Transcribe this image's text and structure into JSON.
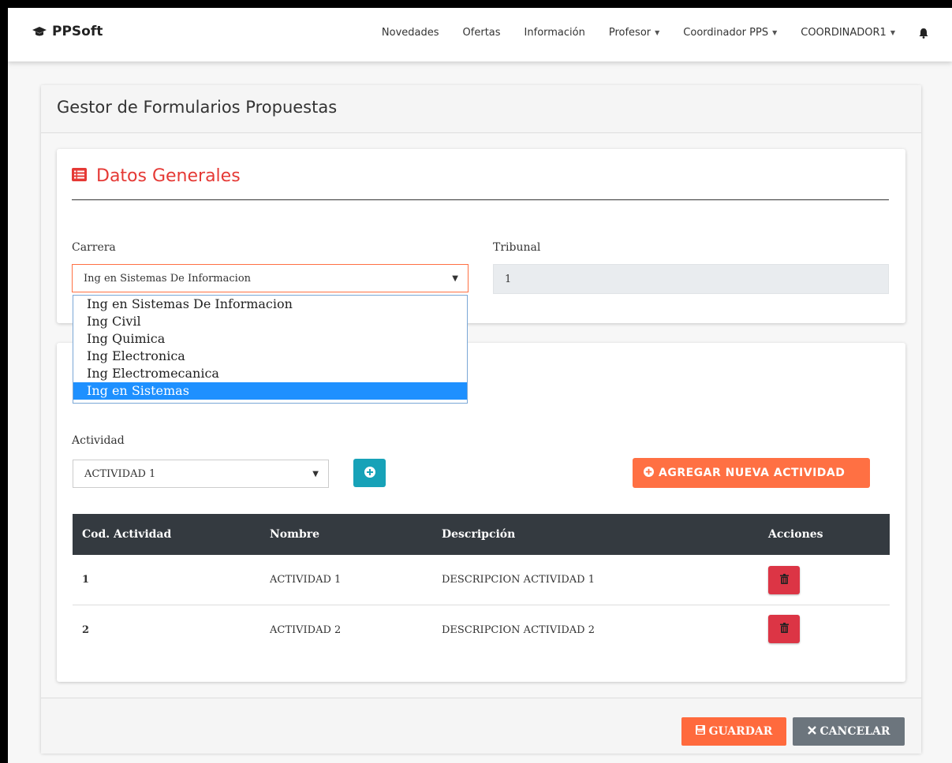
{
  "navbar": {
    "brand": "PPSoft",
    "items": [
      {
        "label": "Novedades",
        "dropdown": false
      },
      {
        "label": "Ofertas",
        "dropdown": false
      },
      {
        "label": "Información",
        "dropdown": false
      },
      {
        "label": "Profesor",
        "dropdown": true
      },
      {
        "label": "Coordinador PPS",
        "dropdown": true
      },
      {
        "label": "COORDINADOR1",
        "dropdown": true
      }
    ],
    "notification_icon": "bell-icon"
  },
  "page": {
    "title": "Gestor de Formularios Propuestas"
  },
  "datos_generales": {
    "title": "Datos Generales",
    "icon": "list-alt-icon",
    "carrera_label": "Carrera",
    "carrera_value": "Ing en Sistemas De Informacion",
    "carrera_options": [
      "Ing en Sistemas De Informacion",
      "Ing Civil",
      "Ing Quimica",
      "Ing Electronica",
      "Ing Electromecanica",
      "Ing en Sistemas"
    ],
    "carrera_highlighted": "Ing en Sistemas",
    "tribunal_label": "Tribunal",
    "tribunal_value": "1"
  },
  "actividades": {
    "label": "Actividad",
    "selected": "ACTIVIDAD 1",
    "add_button": "AGREGAR NUEVA ACTIVIDAD",
    "columns": [
      "Cod. Actividad",
      "Nombre",
      "Descripción",
      "Acciones"
    ],
    "rows": [
      {
        "cod": "1",
        "nombre": "ACTIVIDAD 1",
        "descripcion": "DESCRIPCION ACTIVIDAD 1"
      },
      {
        "cod": "2",
        "nombre": "ACTIVIDAD 2",
        "descripcion": "DESCRIPCION ACTIVIDAD 2"
      }
    ]
  },
  "footer": {
    "save_label": "GUARDAR",
    "cancel_label": "CANCELAR"
  },
  "colors": {
    "accent_red": "#e53935",
    "orange": "#ff7043",
    "teal": "#17a2b8",
    "table_header": "#343a40",
    "danger": "#dc3545",
    "secondary": "#6c757d"
  }
}
